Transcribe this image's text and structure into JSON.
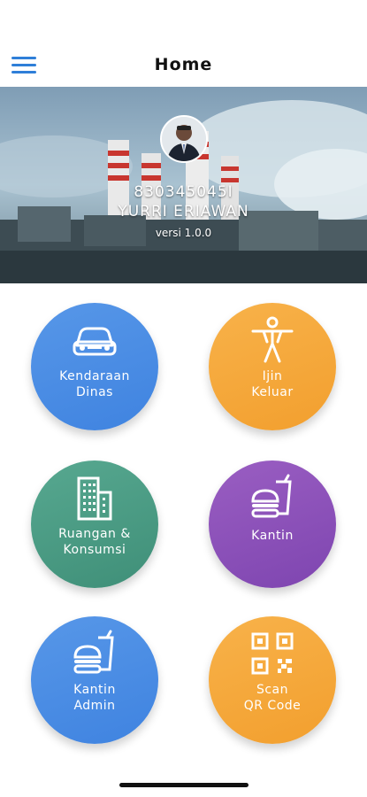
{
  "header": {
    "title": "Home",
    "menu_icon": "hamburger-menu-icon"
  },
  "profile": {
    "employee_id": "830345045I",
    "name": "YURRI ERIAWAN",
    "version": "versi 1.0.0"
  },
  "menu": [
    {
      "line1": "Kendaraan",
      "line2": "Dinas",
      "icon": "car-icon",
      "color": "#4a8ee6"
    },
    {
      "line1": "Ijin",
      "line2": "Keluar",
      "icon": "person-icon",
      "color": "#f5a83b"
    },
    {
      "line1": "Ruangan &",
      "line2": "Konsumsi",
      "icon": "building-icon",
      "color": "#4c9e86"
    },
    {
      "line1": "Kantin",
      "line2": "",
      "icon": "burger-drink-icon",
      "color": "#8b52b9"
    },
    {
      "line1": "Kantin",
      "line2": "Admin",
      "icon": "burger-drink-icon",
      "color": "#4a8ee6"
    },
    {
      "line1": "Scan",
      "line2": "QR Code",
      "icon": "qr-code-icon",
      "color": "#f5a83b"
    }
  ]
}
